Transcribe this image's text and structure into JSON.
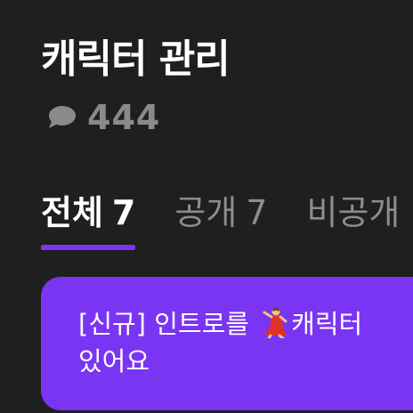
{
  "header": {
    "title": "캐릭터 관리",
    "comment_count": "444",
    "comment_icon": "speech-bubble-icon"
  },
  "tabs": [
    {
      "label": "전체",
      "count": "7",
      "active": true
    },
    {
      "label": "공개",
      "count": "7",
      "active": false
    },
    {
      "label": "비공개",
      "count": "",
      "active": false
    }
  ],
  "banner": {
    "line1_prefix": "[신규] 인트로를",
    "emoji": "dancing-woman-icon",
    "line1_suffix": "캐릭터",
    "line2": "있어요"
  },
  "colors": {
    "background": "#1f1f1f",
    "accent": "#7a35f2",
    "muted_text": "#8c8c8c"
  }
}
